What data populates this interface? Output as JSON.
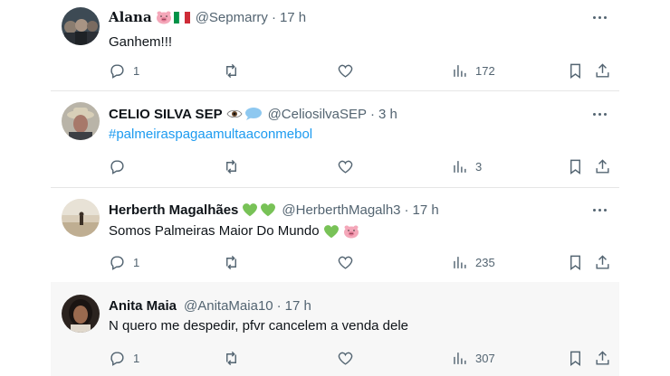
{
  "posts": [
    {
      "name": "Alana",
      "emojis": [
        "pig-face",
        "flag-italy"
      ],
      "handle": "@Sepmarry",
      "separator": "·",
      "time": "17 h",
      "text": "Ganhem!!!",
      "replies": "1",
      "reposts": "",
      "likes": "",
      "views": "172",
      "highlighted": false
    },
    {
      "name": "CELIO SILVA SEP",
      "emojis": [
        "eye",
        "speech-bubble"
      ],
      "handle": "@CeliosilvaSEP",
      "separator": "·",
      "time": "3 h",
      "text": "#palmeiraspagaamultaaconmebol",
      "replies": "",
      "reposts": "",
      "likes": "",
      "views": "3",
      "highlighted": false
    },
    {
      "name": "Herberth Magalhães",
      "emojis": [
        "green-heart",
        "green-heart"
      ],
      "handle": "@HerberthMagalh3",
      "separator": "·",
      "time": "17 h",
      "text": "Somos Palmeiras Maior Do Mundo",
      "text_emojis": [
        "green-heart",
        "pig-face"
      ],
      "replies": "1",
      "reposts": "",
      "likes": "",
      "views": "235",
      "highlighted": false
    },
    {
      "name": "Anita Maia",
      "emojis": [],
      "handle": "@AnitaMaia10",
      "separator": "·",
      "time": "17 h",
      "text": "N quero me despedir, pfvr cancelem a venda dele",
      "replies": "1",
      "reposts": "",
      "likes": "",
      "views": "307",
      "highlighted": true
    }
  ],
  "colors": {
    "text": "#0f1419",
    "secondary": "#536471",
    "hashtag": "#1d9bf0",
    "divider": "#e6e6e6",
    "highlight_bg": "#f7f7f7"
  },
  "icons": [
    "reply-icon",
    "repost-icon",
    "like-icon",
    "views-icon",
    "bookmark-icon",
    "share-icon",
    "more-icon"
  ]
}
